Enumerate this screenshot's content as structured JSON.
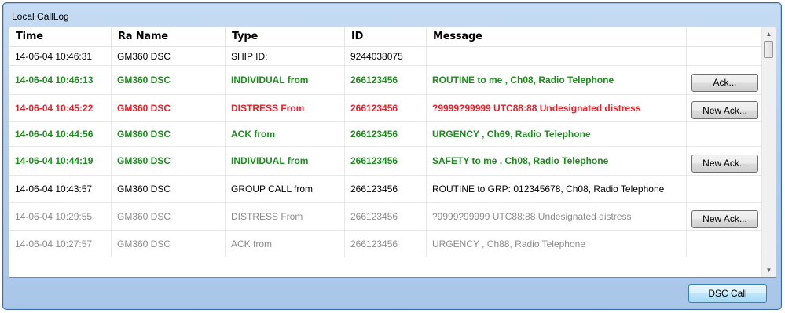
{
  "window": {
    "title": "Local CallLog"
  },
  "columns": [
    "Time",
    "Ra Name",
    "Type",
    "ID",
    "Message",
    ""
  ],
  "colors": {
    "green": "#1e8c1e",
    "red": "#e8202a",
    "black": "#000000",
    "gray": "#8c8c8c"
  },
  "rows": [
    {
      "time": "14-06-04  10:46:31",
      "name": "GM360 DSC",
      "type": "SHIP ID:",
      "id": "9244038075",
      "message": "",
      "action": "",
      "color": "black",
      "bold": false,
      "height": 24
    },
    {
      "time": "14-06-04  10:46:13",
      "name": "GM360 DSC",
      "type": "INDIVIDUAL from",
      "id": "266123456",
      "message": "ROUTINE to me , Ch08, Radio Telephone",
      "action": "Ack...",
      "color": "green",
      "bold": true,
      "height": 37
    },
    {
      "time": "14-06-04  10:45:22",
      "name": "GM360 DSC",
      "type": "DISTRESS From",
      "id": "266123456",
      "message": "?9999?99999 UTC88:88 Undesignated distress",
      "action": "New Ack...",
      "color": "red",
      "bold": true,
      "height": 34
    },
    {
      "time": "14-06-04  10:44:56",
      "name": "GM360 DSC",
      "type": "ACK from",
      "id": "266123456",
      "message": "URGENCY , Ch69, Radio Telephone",
      "action": "",
      "color": "green",
      "bold": true,
      "height": 32
    },
    {
      "time": "14-06-04  10:44:19",
      "name": "GM360 DSC",
      "type": "INDIVIDUAL from",
      "id": "266123456",
      "message": "SAFETY to me , Ch08, Radio Telephone",
      "action": "New Ack...",
      "color": "green",
      "bold": true,
      "height": 37
    },
    {
      "time": "14-06-04  10:43:57",
      "name": "GM360 DSC",
      "type": "GROUP CALL from",
      "id": "266123456",
      "message": "ROUTINE to GRP: 012345678, Ch08, Radio Telephone",
      "action": "",
      "color": "black",
      "bold": false,
      "height": 35
    },
    {
      "time": "14-06-04  10:29:55",
      "name": "GM360 DSC",
      "type": "DISTRESS From",
      "id": "266123456",
      "message": "?9999?99999 UTC88:88 Undesignated distress",
      "action": "New Ack...",
      "color": "gray",
      "bold": false,
      "height": 35
    },
    {
      "time": "14-06-04  10:27:57",
      "name": "GM360 DSC",
      "type": "ACK from",
      "id": "266123456",
      "message": "URGENCY , Ch88, Radio Telephone",
      "action": "",
      "color": "gray",
      "bold": false,
      "height": 34
    }
  ],
  "footer": {
    "dsc_call_label": "DSC Call"
  },
  "icons": {
    "scroll_up": "▲",
    "scroll_down": "▼"
  }
}
